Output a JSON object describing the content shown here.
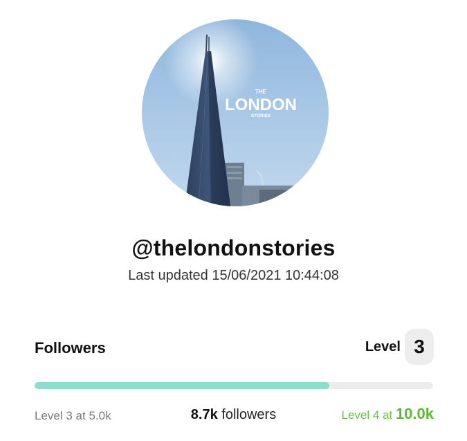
{
  "profile": {
    "avatar_text_top": "THE",
    "avatar_text_main": "LONDON",
    "avatar_text_bottom": "STORIES",
    "username": "@thelondonstories",
    "last_updated": "Last updated 15/06/2021 10:44:08"
  },
  "followers": {
    "title": "Followers",
    "level_label": "Level",
    "level_value": "3",
    "progress_fraction": 0.74,
    "current_level_text": "Level 3 at 5.0k",
    "count_value": "8.7k",
    "count_suffix": " followers",
    "next_level_prefix": "Level 4 at ",
    "next_level_value": "10.0k"
  },
  "colors": {
    "progress_fill": "#8edccb",
    "progress_track": "#ececec",
    "next_level_green": "#5db83a"
  }
}
